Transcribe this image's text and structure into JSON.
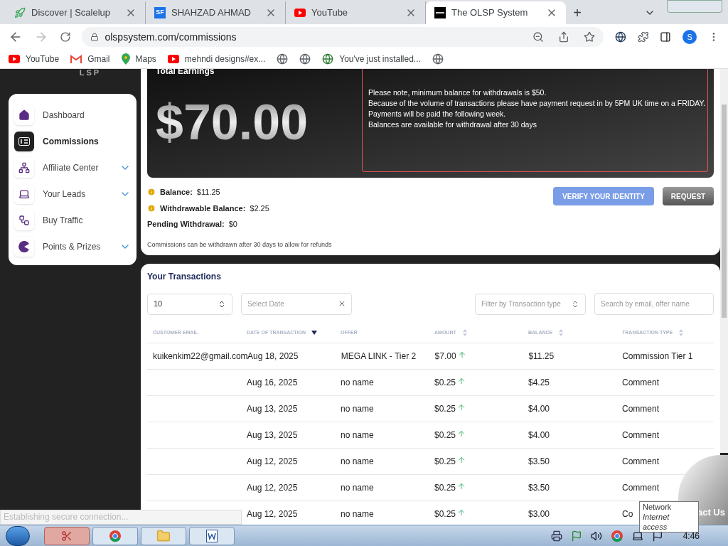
{
  "browser": {
    "tabs": [
      {
        "kind": "rocket",
        "title": "Discover | Scalelup",
        "selected": false
      },
      {
        "kind": "sf",
        "icon_text": "SF",
        "title": "SHAHZAD AHMAD",
        "selected": false
      },
      {
        "kind": "youtube",
        "title": "YouTube",
        "selected": false
      },
      {
        "kind": "olsp",
        "title": "The OLSP System",
        "selected": true
      }
    ],
    "new_tab": "+",
    "url": "olspsystem.com/commissions",
    "profile": "S",
    "bookmarks": [
      {
        "kind": "youtube",
        "label": "YouTube"
      },
      {
        "kind": "gmail",
        "label": "Gmail"
      },
      {
        "kind": "maps",
        "label": "Maps"
      },
      {
        "kind": "youtube",
        "label": "mehndi designs#ex..."
      },
      {
        "kind": "globe"
      },
      {
        "kind": "globe"
      },
      {
        "kind": "earth",
        "label": "You've just installed..."
      },
      {
        "kind": "globe"
      }
    ]
  },
  "sidebar": {
    "logo_text": "LSP",
    "items": [
      {
        "label": "Dashboard",
        "selected": false,
        "expandable": false
      },
      {
        "label": "Commissions",
        "selected": true,
        "expandable": false
      },
      {
        "label": "Affiliate Center",
        "selected": false,
        "expandable": true
      },
      {
        "label": "Your Leads",
        "selected": false,
        "expandable": true
      },
      {
        "label": "Buy Traffic",
        "selected": false,
        "expandable": false
      },
      {
        "label": "Points & Prizes",
        "selected": false,
        "expandable": true
      }
    ]
  },
  "earnings": {
    "title": "Total Earnings",
    "amount": "$70.00",
    "notice": [
      "Please note, minimum balance for withdrawals is $50.",
      "Because of the volume of transactions please have payment request in by 5PM UK time on a FRIDAY.",
      "Payments will be paid the following week.",
      "Balances are available for withdrawal after 30 days"
    ]
  },
  "balances": [
    {
      "label": "Balance:",
      "value": "$11.25",
      "info": true
    },
    {
      "label": "Withdrawable Balance:",
      "value": "$2.25",
      "info": true
    },
    {
      "label": "Pending Withdrawal:",
      "value": "$0",
      "info": false
    }
  ],
  "balance_note": "Commissions can be withdrawn after 30 days to allow for refunds",
  "buttons": [
    {
      "kind": "primary",
      "label": "VERIFY YOUR IDENTITY"
    },
    {
      "kind": "secondary",
      "label": "REQUEST"
    }
  ],
  "transactions": {
    "title": "Your Transactions",
    "page_size": "10",
    "date_placeholder": "Select Date",
    "type_placeholder": "Filter by Transaction type",
    "search_placeholder": "Search by email, offer name",
    "columns": [
      {
        "label": "CUSTOMER EMAIL",
        "sortable": false
      },
      {
        "label": "DATE OF TRANSACTION",
        "sortable": true,
        "sorted": true
      },
      {
        "label": "OFFER",
        "sortable": false
      },
      {
        "label": "AMOUNT",
        "sortable": true,
        "sorted": false
      },
      {
        "label": "BALANCE",
        "sortable": true,
        "sorted": false
      },
      {
        "label": "TRANSACTION TYPE",
        "sortable": true,
        "sorted": false
      }
    ],
    "rows": [
      {
        "email": "kuikenkim22@gmail.com",
        "date": "Aug 18, 2025",
        "offer": "MEGA LINK - Tier 2",
        "amount": "$7.00",
        "rising": true,
        "balance": "$11.25",
        "type": "Commission Tier 1"
      },
      {
        "date": "Aug 16, 2025",
        "offer": "no name",
        "amount": "$0.25",
        "rising": true,
        "balance": "$4.25",
        "type": "Comment"
      },
      {
        "date": "Aug 13, 2025",
        "offer": "no name",
        "amount": "$0.25",
        "rising": true,
        "balance": "$4.00",
        "type": "Comment"
      },
      {
        "date": "Aug 13, 2025",
        "offer": "no name",
        "amount": "$0.25",
        "rising": true,
        "balance": "$4.00",
        "type": "Comment"
      },
      {
        "date": "Aug 12, 2025",
        "offer": "no name",
        "amount": "$0.25",
        "rising": true,
        "balance": "$3.50",
        "type": "Comment"
      },
      {
        "date": "Aug 12, 2025",
        "offer": "no name",
        "amount": "$0.25",
        "rising": true,
        "balance": "$3.50",
        "type": "Comment"
      },
      {
        "date": "Aug 12, 2025",
        "offer": "no name",
        "amount": "$0.25",
        "rising": true,
        "balance": "$3.00",
        "type": "Co"
      }
    ]
  },
  "contact_text": "act Us",
  "status_text": "Establishing secure connection...",
  "tooltip": {
    "title": "Network",
    "subtitle": "Internet access"
  },
  "taskbar": {
    "apps": [
      {
        "kind": "snip",
        "selected": true
      },
      {
        "kind": "chrome",
        "selected": false
      },
      {
        "kind": "folder",
        "selected": false
      },
      {
        "kind": "word",
        "selected": false
      }
    ],
    "clock": "4:46"
  }
}
